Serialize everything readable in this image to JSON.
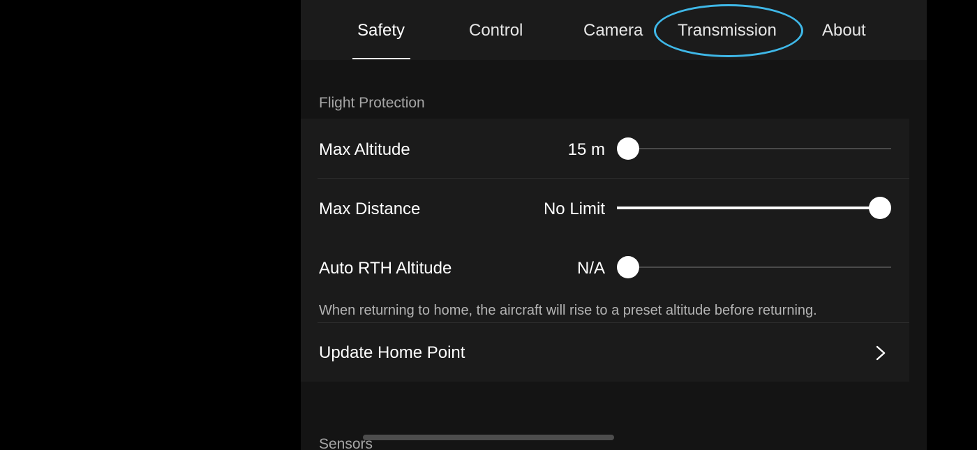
{
  "tabs": [
    {
      "label": "Safety",
      "active": true
    },
    {
      "label": "Control",
      "active": false
    },
    {
      "label": "Camera",
      "active": false
    },
    {
      "label": "Transmission",
      "active": false,
      "highlighted": true
    },
    {
      "label": "About",
      "active": false
    }
  ],
  "flight_protection": {
    "title": "Flight Protection",
    "max_altitude": {
      "label": "Max Altitude",
      "value": "15 m",
      "slider_fraction": 0.0
    },
    "max_distance": {
      "label": "Max Distance",
      "value": "No Limit",
      "slider_fraction": 1.0
    },
    "auto_rth_altitude": {
      "label": "Auto RTH Altitude",
      "value": "N/A",
      "slider_fraction": 0.0
    },
    "rth_hint": "When returning to home, the aircraft will rise to a preset altitude before returning.",
    "update_home_point": {
      "label": "Update Home Point",
      "icon": "chevron-right-icon"
    }
  },
  "sensors": {
    "title": "Sensors"
  },
  "colors": {
    "highlight_ring": "#3fb8e8",
    "panel_background": "#141414",
    "card_background": "#1b1b1b",
    "slider_fill": "#ffffff",
    "slider_track": "#4a4a4a"
  }
}
